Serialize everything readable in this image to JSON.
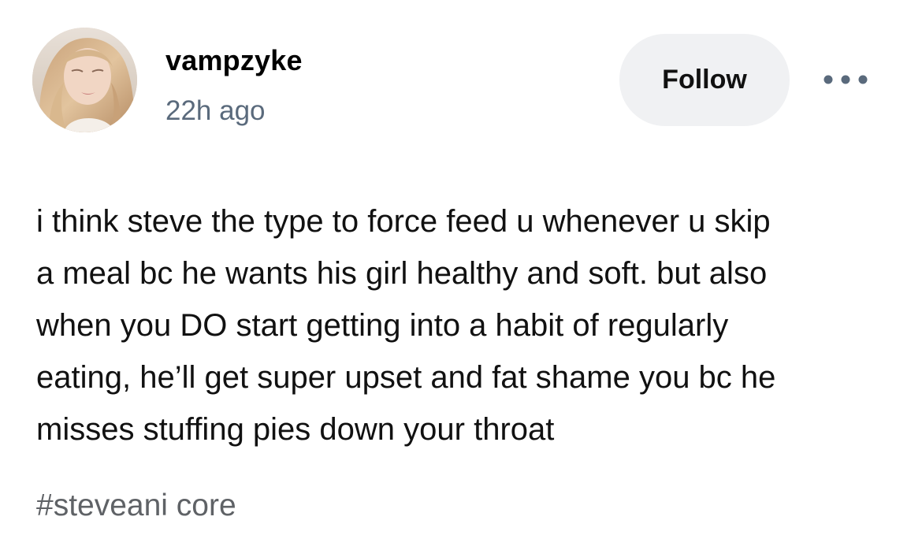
{
  "post": {
    "author": {
      "username": "vampzyke",
      "timestamp": "22h ago",
      "avatar": "profile-photo"
    },
    "follow_label": "Follow",
    "more_icon": "ellipsis-icon",
    "body_lines": [
      "i think steve the type to force feed u whenever u skip",
      "a meal bc he wants his girl healthy and soft. but also",
      "when you DO start getting into a habit of regularly",
      "eating, he’ll get super upset and fat shame you bc he",
      "misses stuffing pies down your throat"
    ],
    "tags": [
      "#steveani core"
    ]
  },
  "colors": {
    "follow_bg": "#f0f1f3",
    "timestamp": "#5a6a7c",
    "tag": "#5f6266",
    "more_dots": "#5a6a7c"
  }
}
